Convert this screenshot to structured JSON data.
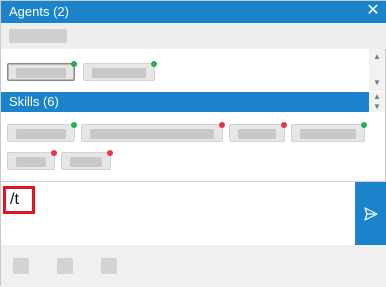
{
  "header": {
    "title": "Agents (2)",
    "close_icon": "close-icon"
  },
  "agents": [
    {
      "status": "online",
      "status_color": "#21b24b",
      "selected": true
    },
    {
      "status": "online",
      "status_color": "#21b24b",
      "selected": false
    }
  ],
  "skills": {
    "title": "Skills (6)",
    "items": [
      {
        "status": "online",
        "status_color": "#21b24b"
      },
      {
        "status": "busy",
        "status_color": "#e8334a"
      },
      {
        "status": "busy",
        "status_color": "#e8334a"
      },
      {
        "status": "online",
        "status_color": "#21b24b"
      },
      {
        "status": "busy",
        "status_color": "#e8334a"
      },
      {
        "status": "busy",
        "status_color": "#e8334a"
      }
    ]
  },
  "composer": {
    "value": "/t",
    "send_icon": "send-icon"
  },
  "colors": {
    "accent": "#1a83cc",
    "highlight": "#e1151b"
  },
  "footer": {
    "tools": [
      "toolbar-icon-1",
      "toolbar-icon-2",
      "toolbar-icon-3"
    ]
  }
}
